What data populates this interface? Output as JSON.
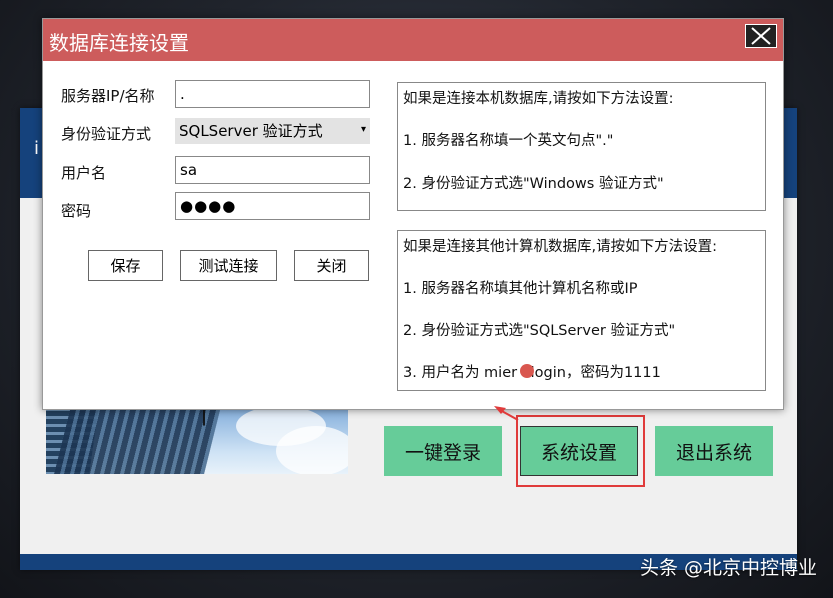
{
  "dialog": {
    "title": "数据库连接设置",
    "labels": {
      "server": "服务器IP/名称",
      "auth": "身份验证方式",
      "username": "用户名",
      "password": "密码"
    },
    "values": {
      "server": ".",
      "auth": "SQLServer 验证方式",
      "username": "sa",
      "password": "●●●●"
    },
    "buttons": {
      "save": "保存",
      "test": "测试连接",
      "close": "关闭"
    },
    "local_info": {
      "heading": "如果是连接本机数据库,请按如下方法设置:",
      "line1": "1. 服务器名称填一个英文句点\".\"",
      "line2": "2. 身份验证方式选\"Windows 验证方式\""
    },
    "remote_info": {
      "heading": "如果是连接其他计算机数据库,请按如下方法设置:",
      "line1": "1. 服务器名称填其他计算机名称或IP",
      "line2": "2. 身份验证方式选\"SQLServer 验证方式\"",
      "line3": "3. 用户名为 mier elogin，密码为1111"
    }
  },
  "background": {
    "header_char": "i",
    "buttons": {
      "login": "一键登录",
      "system": "系统设置",
      "exit": "退出系统"
    }
  },
  "watermark": "头条 @北京中控博业",
  "colors": {
    "titlebar": "#cd5c5c",
    "button_green": "#66cc99",
    "header_blue": "#15427c",
    "highlight": "#e03b3b"
  }
}
